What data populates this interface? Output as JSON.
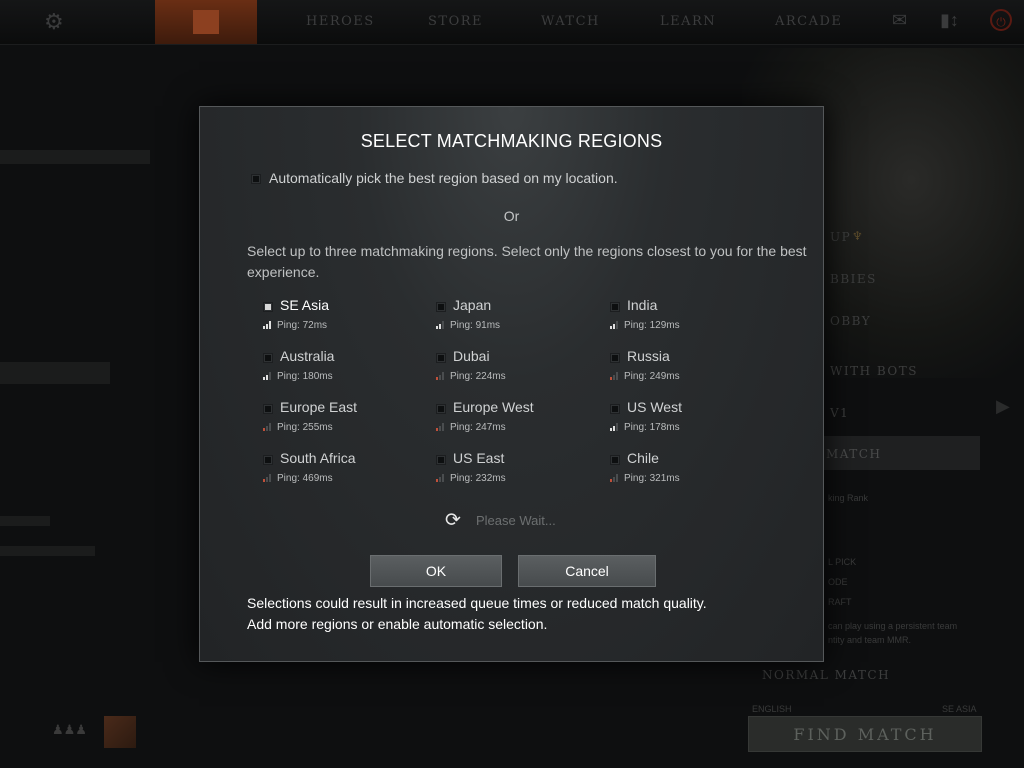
{
  "topbar": {
    "nav": [
      "HEROES",
      "STORE",
      "WATCH",
      "LEARN",
      "ARCADE"
    ]
  },
  "background": {
    "side_menu": [
      "UP",
      "BBIES",
      "OBBY",
      "WITH BOTS",
      "V1"
    ],
    "ranked_label": "MATCH",
    "rank_text": "king Rank",
    "mode_items": [
      "L PICK",
      "ODE",
      "RAFT"
    ],
    "blurb_line1": "can play using a persistent team",
    "blurb_line2": "ntity and team MMR.",
    "normal_match": "NORMAL MATCH",
    "language": "ENGLISH",
    "region": "SE ASIA",
    "find_match": "FIND MATCH"
  },
  "modal": {
    "title": "SELECT MATCHMAKING REGIONS",
    "auto_pick_label": "Automatically pick the best region based on my location.",
    "auto_pick_checked": false,
    "or_label": "Or",
    "instructions": "Select up to three matchmaking regions. Select only the regions closest to you for the best experience.",
    "regions": [
      {
        "name": "SE Asia",
        "ping": "Ping: 72ms",
        "checked": true,
        "signal": 3
      },
      {
        "name": "Japan",
        "ping": "Ping: 91ms",
        "checked": false,
        "signal": 2
      },
      {
        "name": "India",
        "ping": "Ping: 129ms",
        "checked": false,
        "signal": 2
      },
      {
        "name": "Australia",
        "ping": "Ping: 180ms",
        "checked": false,
        "signal": 2
      },
      {
        "name": "Dubai",
        "ping": "Ping: 224ms",
        "checked": false,
        "signal": 1
      },
      {
        "name": "Russia",
        "ping": "Ping: 249ms",
        "checked": false,
        "signal": 1
      },
      {
        "name": "Europe East",
        "ping": "Ping: 255ms",
        "checked": false,
        "signal": 1
      },
      {
        "name": "Europe West",
        "ping": "Ping: 247ms",
        "checked": false,
        "signal": 1
      },
      {
        "name": "US West",
        "ping": "Ping: 178ms",
        "checked": false,
        "signal": 2
      },
      {
        "name": "South Africa",
        "ping": "Ping: 469ms",
        "checked": false,
        "signal": 1
      },
      {
        "name": "US East",
        "ping": "Ping: 232ms",
        "checked": false,
        "signal": 1
      },
      {
        "name": "Chile",
        "ping": "Ping: 321ms",
        "checked": false,
        "signal": 1
      }
    ],
    "status_text": "Please Wait...",
    "ok_label": "OK",
    "cancel_label": "Cancel",
    "warning_line1": "Selections could result in increased queue times or reduced match quality.",
    "warning_line2": "Add more regions or enable automatic selection."
  },
  "colors": {
    "signal_good": "#e0e0e0",
    "signal_mid": "#c9b458",
    "signal_bad": "#c0503a",
    "signal_off": "#4a4d4f"
  }
}
